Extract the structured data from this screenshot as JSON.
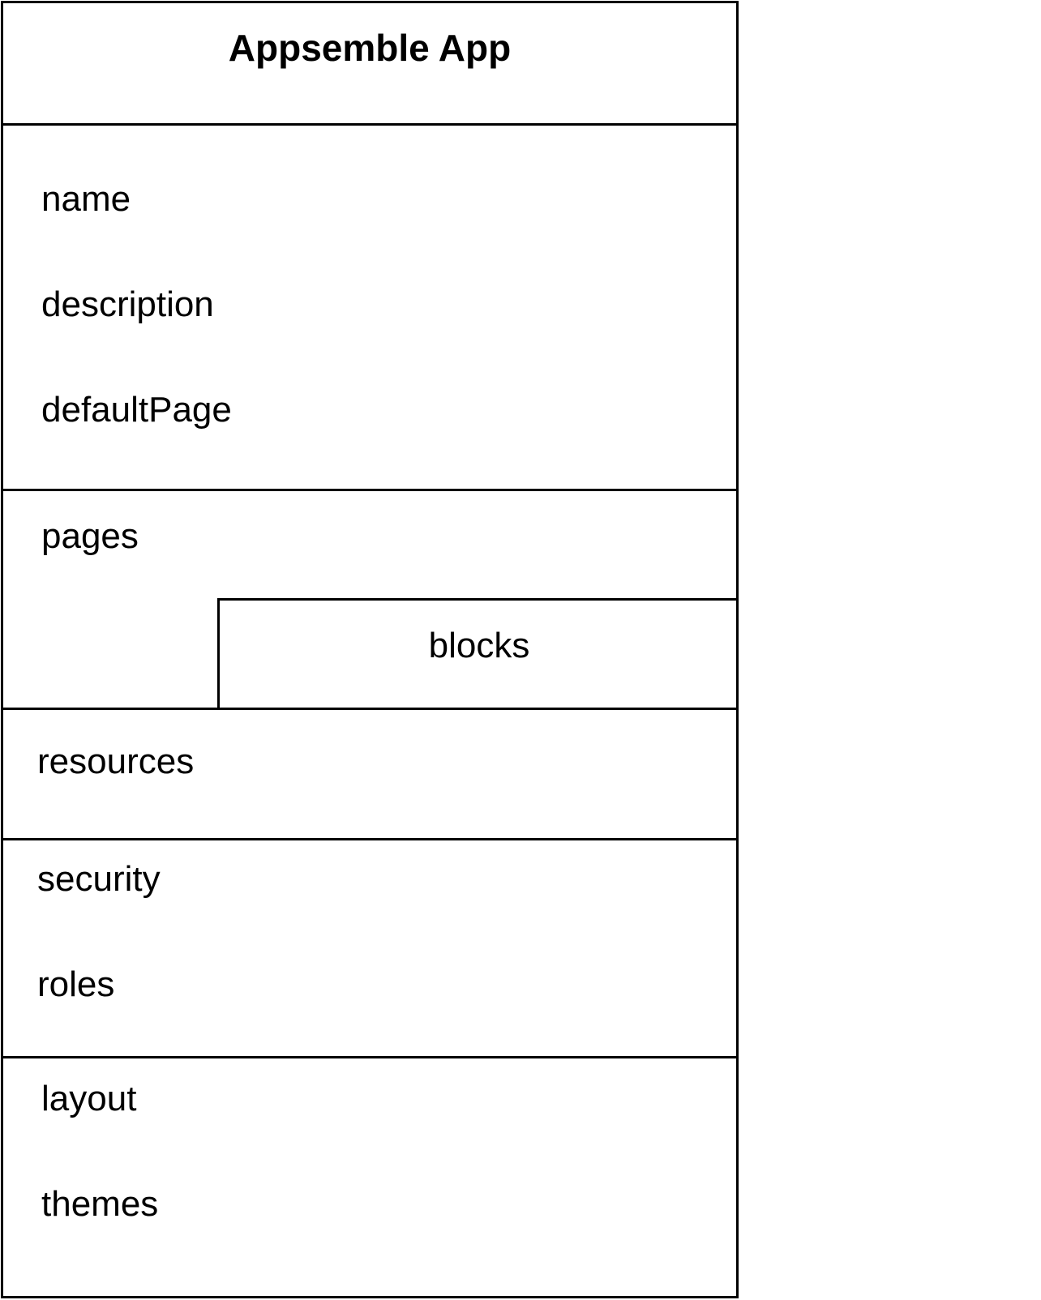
{
  "diagram": {
    "title": "Appsemble App",
    "general": {
      "fields": [
        "name",
        "description",
        "defaultPage"
      ]
    },
    "pages": {
      "label": "pages",
      "child": "blocks"
    },
    "resources": {
      "label": "resources"
    },
    "security": {
      "fields": [
        "security",
        "roles"
      ]
    },
    "appearance": {
      "fields": [
        "layout",
        "themes"
      ]
    }
  }
}
